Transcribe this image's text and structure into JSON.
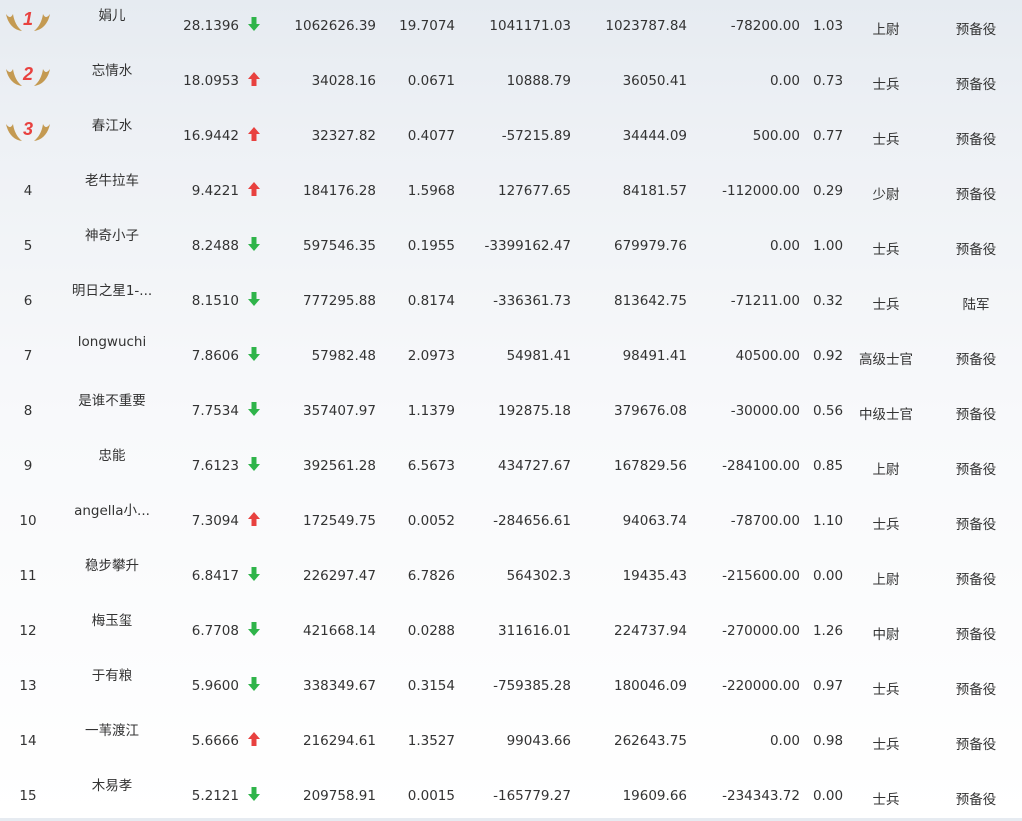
{
  "colors": {
    "up": "#e8413f",
    "down": "#2fb44a",
    "medal_number": "#e8413f",
    "wing": "#c49a52"
  },
  "rows": [
    {
      "rank": "1",
      "medal": true,
      "name": "娟儿",
      "score": "28.1396",
      "trend": "down",
      "v1": "1062626.39",
      "v2": "19.7074",
      "v3": "1041171.03",
      "v4": "1023787.84",
      "v5": "-78200.00",
      "v6": "1.03",
      "rank_title": "上尉",
      "branch": "预备役"
    },
    {
      "rank": "2",
      "medal": true,
      "name": "忘情水",
      "score": "18.0953",
      "trend": "up",
      "v1": "34028.16",
      "v2": "0.0671",
      "v3": "10888.79",
      "v4": "36050.41",
      "v5": "0.00",
      "v6": "0.73",
      "rank_title": "士兵",
      "branch": "预备役"
    },
    {
      "rank": "3",
      "medal": true,
      "name": "春江水",
      "score": "16.9442",
      "trend": "up",
      "v1": "32327.82",
      "v2": "0.4077",
      "v3": "-57215.89",
      "v4": "34444.09",
      "v5": "500.00",
      "v6": "0.77",
      "rank_title": "士兵",
      "branch": "预备役"
    },
    {
      "rank": "4",
      "medal": false,
      "name": "老牛拉车",
      "score": "9.4221",
      "trend": "up",
      "v1": "184176.28",
      "v2": "1.5968",
      "v3": "127677.65",
      "v4": "84181.57",
      "v5": "-112000.00",
      "v6": "0.29",
      "rank_title": "少尉",
      "branch": "预备役"
    },
    {
      "rank": "5",
      "medal": false,
      "name": "神奇小子",
      "score": "8.2488",
      "trend": "down",
      "v1": "597546.35",
      "v2": "0.1955",
      "v3": "-3399162.47",
      "v4": "679979.76",
      "v5": "0.00",
      "v6": "1.00",
      "rank_title": "士兵",
      "branch": "预备役"
    },
    {
      "rank": "6",
      "medal": false,
      "name": "明日之星1-...",
      "score": "8.1510",
      "trend": "down",
      "v1": "777295.88",
      "v2": "0.8174",
      "v3": "-336361.73",
      "v4": "813642.75",
      "v5": "-71211.00",
      "v6": "0.32",
      "rank_title": "士兵",
      "branch": "陆军"
    },
    {
      "rank": "7",
      "medal": false,
      "name": "longwuchi",
      "score": "7.8606",
      "trend": "down",
      "v1": "57982.48",
      "v2": "2.0973",
      "v3": "54981.41",
      "v4": "98491.41",
      "v5": "40500.00",
      "v6": "0.92",
      "rank_title": "高级士官",
      "branch": "预备役"
    },
    {
      "rank": "8",
      "medal": false,
      "name": "是谁不重要",
      "score": "7.7534",
      "trend": "down",
      "v1": "357407.97",
      "v2": "1.1379",
      "v3": "192875.18",
      "v4": "379676.08",
      "v5": "-30000.00",
      "v6": "0.56",
      "rank_title": "中级士官",
      "branch": "预备役"
    },
    {
      "rank": "9",
      "medal": false,
      "name": "忠能",
      "score": "7.6123",
      "trend": "down",
      "v1": "392561.28",
      "v2": "6.5673",
      "v3": "434727.67",
      "v4": "167829.56",
      "v5": "-284100.00",
      "v6": "0.85",
      "rank_title": "上尉",
      "branch": "预备役"
    },
    {
      "rank": "10",
      "medal": false,
      "name": "angella小...",
      "score": "7.3094",
      "trend": "up",
      "v1": "172549.75",
      "v2": "0.0052",
      "v3": "-284656.61",
      "v4": "94063.74",
      "v5": "-78700.00",
      "v6": "1.10",
      "rank_title": "士兵",
      "branch": "预备役"
    },
    {
      "rank": "11",
      "medal": false,
      "name": "稳步攀升",
      "score": "6.8417",
      "trend": "down",
      "v1": "226297.47",
      "v2": "6.7826",
      "v3": "564302.3",
      "v4": "19435.43",
      "v5": "-215600.00",
      "v6": "0.00",
      "rank_title": "上尉",
      "branch": "预备役"
    },
    {
      "rank": "12",
      "medal": false,
      "name": "梅玉玺",
      "score": "6.7708",
      "trend": "down",
      "v1": "421668.14",
      "v2": "0.0288",
      "v3": "311616.01",
      "v4": "224737.94",
      "v5": "-270000.00",
      "v6": "1.26",
      "rank_title": "中尉",
      "branch": "预备役"
    },
    {
      "rank": "13",
      "medal": false,
      "name": "于有粮",
      "score": "5.9600",
      "trend": "down",
      "v1": "338349.67",
      "v2": "0.3154",
      "v3": "-759385.28",
      "v4": "180046.09",
      "v5": "-220000.00",
      "v6": "0.97",
      "rank_title": "士兵",
      "branch": "预备役"
    },
    {
      "rank": "14",
      "medal": false,
      "name": "一苇渡江",
      "score": "5.6666",
      "trend": "up",
      "v1": "216294.61",
      "v2": "1.3527",
      "v3": "99043.66",
      "v4": "262643.75",
      "v5": "0.00",
      "v6": "0.98",
      "rank_title": "士兵",
      "branch": "预备役"
    },
    {
      "rank": "15",
      "medal": false,
      "name": "木易孝",
      "score": "5.2121",
      "trend": "down",
      "v1": "209758.91",
      "v2": "0.0015",
      "v3": "-165779.27",
      "v4": "19609.66",
      "v5": "-234343.72",
      "v6": "0.00",
      "rank_title": "士兵",
      "branch": "预备役"
    }
  ]
}
